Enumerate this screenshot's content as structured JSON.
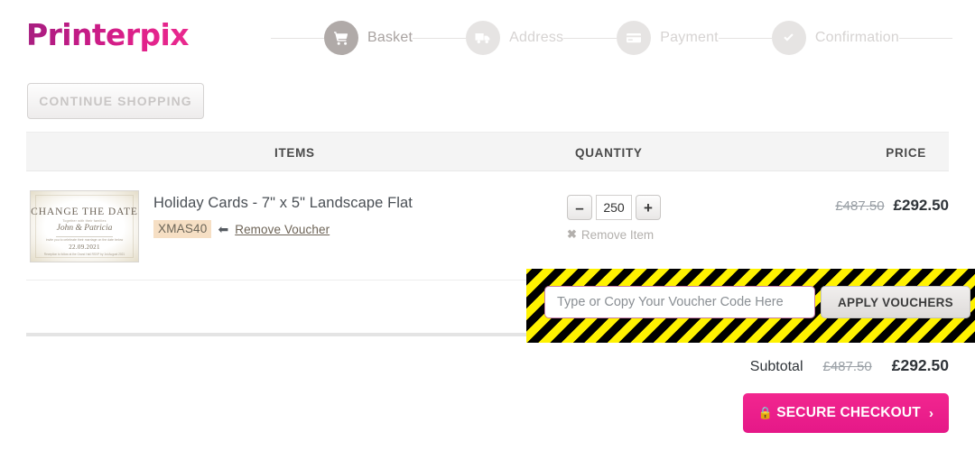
{
  "brand": {
    "name": "Printerpix",
    "color": "#d0218a"
  },
  "stepper": {
    "steps": [
      {
        "label": "Basket",
        "icon": "shopping-cart-icon",
        "state": "active"
      },
      {
        "label": "Address",
        "icon": "delivery-truck-icon",
        "state": "idle"
      },
      {
        "label": "Payment",
        "icon": "credit-card-icon",
        "state": "idle"
      },
      {
        "label": "Confirmation",
        "icon": "check-circle-icon",
        "state": "idle"
      }
    ]
  },
  "toolbar": {
    "continue_shopping_label": "CONTINUE SHOPPING"
  },
  "table": {
    "headers": {
      "items": "ITEMS",
      "quantity": "QUANTITY",
      "price": "PRICE"
    },
    "rows": [
      {
        "title": "Holiday Cards - 7\" x 5\" Landscape Flat",
        "voucher_code": "XMAS40",
        "remove_voucher_label": "Remove Voucher",
        "quantity": "250",
        "decrement_label": "–",
        "increment_label": "+",
        "remove_item_label": "Remove Item",
        "price_original": "£487.50",
        "price_current": "£292.50",
        "thumbnail": {
          "heading": "CHANGE THE DATE",
          "sub1": "Together with their families",
          "names": "John & Patricia",
          "sub2": "invite you to celebrate their marriage on the date below",
          "date": "22.09.2021",
          "footer": "Reception to follow at the Grand Hall\nRSVP by 1st August 2021"
        }
      }
    ]
  },
  "voucher": {
    "placeholder": "Type or Copy Your Voucher Code Here",
    "value": "",
    "apply_label": "APPLY VOUCHERS",
    "highlight_color": "#fff200"
  },
  "summary": {
    "subtotal_label": "Subtotal",
    "subtotal_original": "£487.50",
    "subtotal_current": "£292.50"
  },
  "checkout": {
    "label": "SECURE CHECKOUT",
    "lock_icon": "lock-icon",
    "chevron": "›",
    "color": "#e51888"
  }
}
